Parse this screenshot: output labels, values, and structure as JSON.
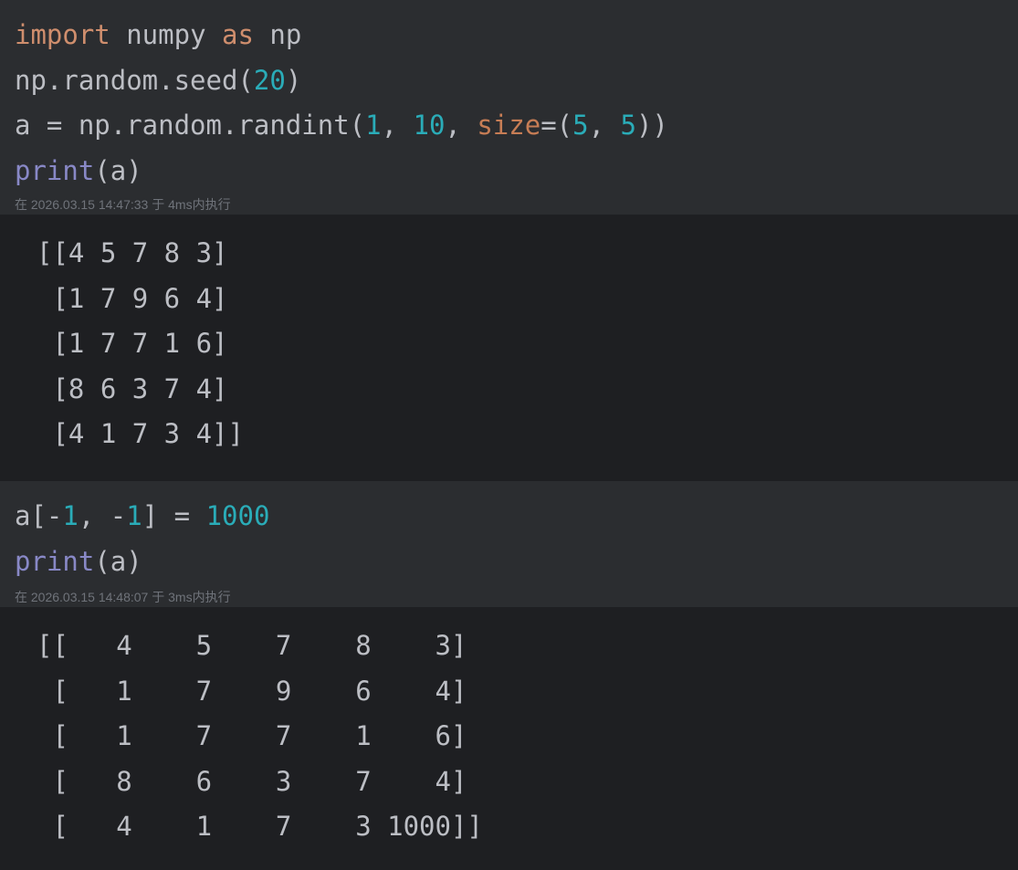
{
  "cells": [
    {
      "code": [
        [
          {
            "t": "import",
            "c": "kw"
          },
          {
            "t": " numpy "
          },
          {
            "t": "as",
            "c": "kw"
          },
          {
            "t": " np"
          }
        ],
        [
          {
            "t": "np.random.seed("
          },
          {
            "t": "20",
            "c": "num"
          },
          {
            "t": ")"
          }
        ],
        [
          {
            "t": "a = np.random.randint("
          },
          {
            "t": "1",
            "c": "num"
          },
          {
            "t": ", "
          },
          {
            "t": "10",
            "c": "num"
          },
          {
            "t": ", "
          },
          {
            "t": "size",
            "c": "param"
          },
          {
            "t": "=("
          },
          {
            "t": "5",
            "c": "num"
          },
          {
            "t": ", "
          },
          {
            "t": "5",
            "c": "num"
          },
          {
            "t": "))"
          }
        ],
        [
          {
            "t": "print",
            "c": "builtin"
          },
          {
            "t": "(a)"
          }
        ]
      ],
      "meta": "在 2026.03.15 14:47:33 于 4ms内执行",
      "output": [
        "[[4 5 7 8 3]",
        " [1 7 9 6 4]",
        " [1 7 7 1 6]",
        " [8 6 3 7 4]",
        " [4 1 7 3 4]]"
      ]
    },
    {
      "code": [
        [
          {
            "t": "a[-"
          },
          {
            "t": "1",
            "c": "num"
          },
          {
            "t": ", -"
          },
          {
            "t": "1",
            "c": "num"
          },
          {
            "t": "] = "
          },
          {
            "t": "1000",
            "c": "num"
          }
        ],
        [
          {
            "t": "print",
            "c": "builtin"
          },
          {
            "t": "(a)"
          }
        ]
      ],
      "meta": "在 2026.03.15 14:48:07 于 3ms内执行",
      "output": [
        "[[   4    5    7    8    3]",
        " [   1    7    9    6    4]",
        " [   1    7    7    1    6]",
        " [   8    6    3    7    4]",
        " [   4    1    7    3 1000]]"
      ]
    }
  ]
}
